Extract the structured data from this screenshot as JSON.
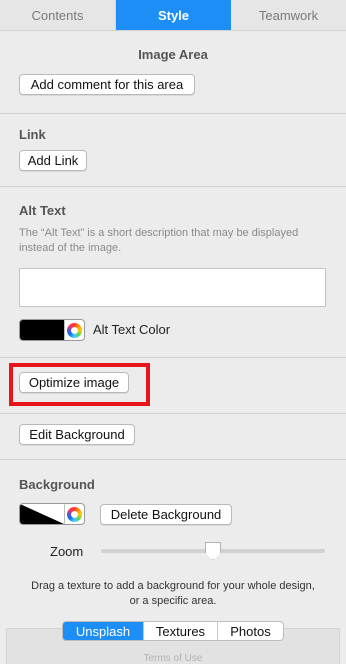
{
  "tabs": [
    {
      "label": "Contents"
    },
    {
      "label": "Style"
    },
    {
      "label": "Teamwork"
    }
  ],
  "image_area": {
    "heading": "Image Area",
    "comment_button": "Add comment for this area"
  },
  "link": {
    "heading": "Link",
    "add_button": "Add Link"
  },
  "alt_text": {
    "heading": "Alt Text",
    "description": "The “Alt Text” is a short description that may be displayed instead of the image.",
    "value": "",
    "color_label": "Alt Text Color",
    "swatch_color": "#000000"
  },
  "optimize": {
    "button": "Optimize image",
    "highlight_color": "#e8141c"
  },
  "edit_background": {
    "button": "Edit Background"
  },
  "background": {
    "heading": "Background",
    "delete_button": "Delete Background",
    "zoom_label": "Zoom",
    "zoom_level": 0.5,
    "hint": "Drag a texture to add a background for your whole design, or a specific area.",
    "sources": [
      {
        "label": "Unsplash"
      },
      {
        "label": "Textures"
      },
      {
        "label": "Photos"
      }
    ],
    "terms": "Terms of Use"
  },
  "colors": {
    "accent": "#1d8ef5",
    "panel": "#ececec"
  }
}
